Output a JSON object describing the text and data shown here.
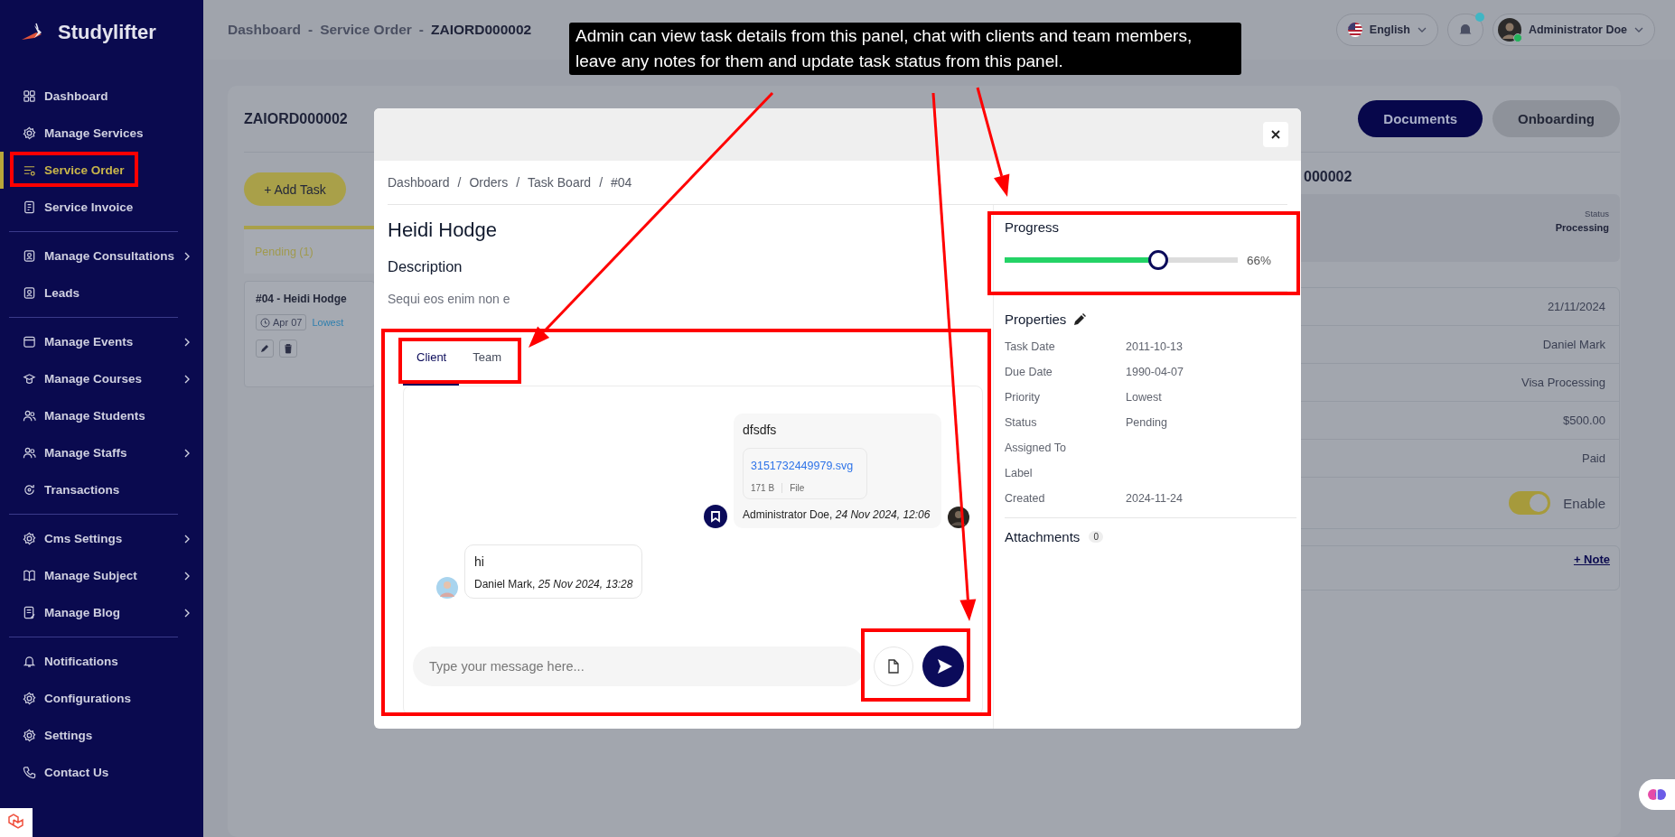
{
  "sidebar": {
    "brand": "Studylifter",
    "groups": [
      [
        {
          "label": "Dashboard",
          "selected": false,
          "has_submenu": false
        },
        {
          "label": "Manage Services",
          "selected": false,
          "has_submenu": false
        },
        {
          "label": "Service Order",
          "selected": true,
          "has_submenu": false
        },
        {
          "label": "Service Invoice",
          "selected": false,
          "has_submenu": false
        }
      ],
      [
        {
          "label": "Manage Consultations",
          "selected": false,
          "has_submenu": true
        },
        {
          "label": "Leads",
          "selected": false,
          "has_submenu": false
        }
      ],
      [
        {
          "label": "Manage Events",
          "selected": false,
          "has_submenu": true
        },
        {
          "label": "Manage Courses",
          "selected": false,
          "has_submenu": true
        },
        {
          "label": "Manage Students",
          "selected": false,
          "has_submenu": false
        },
        {
          "label": "Manage Staffs",
          "selected": false,
          "has_submenu": true
        },
        {
          "label": "Transactions",
          "selected": false,
          "has_submenu": false
        }
      ],
      [
        {
          "label": "Cms Settings",
          "selected": false,
          "has_submenu": true
        },
        {
          "label": "Manage Subject",
          "selected": false,
          "has_submenu": true
        },
        {
          "label": "Manage Blog",
          "selected": false,
          "has_submenu": true
        }
      ],
      [
        {
          "label": "Notifications",
          "selected": false,
          "has_submenu": false
        },
        {
          "label": "Configurations",
          "selected": false,
          "has_submenu": false
        },
        {
          "label": "Settings",
          "selected": false,
          "has_submenu": false
        },
        {
          "label": "Contact Us",
          "selected": false,
          "has_submenu": false
        }
      ]
    ]
  },
  "topbar": {
    "breadcrumb": [
      "Dashboard",
      "Service Order",
      "ZAIORD000002"
    ],
    "breadcrumb_separator": "-",
    "language": "English",
    "has_unread": true,
    "user": "Administrator Doe",
    "online": true
  },
  "page": {
    "order_id": "ZAIORD000002",
    "buttons": [
      {
        "label": "Documents",
        "selected": true
      },
      {
        "label": "Onboarding",
        "selected": false
      }
    ],
    "add_task": "+ Add Task",
    "column": {
      "title": "Pending (1)",
      "cards": [
        {
          "title": "#04 - Heidi Hodge",
          "date": "Apr 07",
          "priority": "Lowest"
        }
      ]
    },
    "heading_partial": "000002",
    "status_label": "Status",
    "status_value": "Processing",
    "details": [
      {
        "kind": "text",
        "value": "21/11/2024"
      },
      {
        "kind": "text",
        "value": "Daniel Mark"
      },
      {
        "kind": "text",
        "value": "Visa Processing"
      },
      {
        "kind": "text",
        "value": "$500.00"
      },
      {
        "kind": "text",
        "value": "Paid"
      },
      {
        "kind": "toggle",
        "on": true,
        "value": "Enable"
      }
    ],
    "note_link": "+ Note"
  },
  "modal": {
    "breadcrumb": [
      "Dashboard",
      "Orders",
      "Task Board",
      "#04"
    ],
    "breadcrumb_separator": "/",
    "title": "Heidi Hodge",
    "description_heading": "Description",
    "description": "Sequi eos enim non e",
    "chat": {
      "tabs": [
        {
          "label": "Client",
          "selected": true
        },
        {
          "label": "Team",
          "selected": false
        }
      ],
      "messages": [
        {
          "kind": "outgoing",
          "text": "dfsdfs",
          "file": {
            "name": "3151732449979.svg",
            "size": "171 B",
            "type": "File"
          },
          "meta": "Administrator Doe, *24 Nov 2024, 12:06*"
        },
        {
          "kind": "incoming",
          "text": "hi",
          "meta": "Daniel Mark, *25 Nov 2024, 13:28*"
        }
      ],
      "placeholder": "Type your message here..."
    },
    "progress": {
      "label": "Progress",
      "level": 0.66,
      "reading": "66%"
    },
    "properties": {
      "heading": "Properties",
      "rows": [
        {
          "label": "Task Date",
          "value": "2011-10-13"
        },
        {
          "label": "Due Date",
          "value": "1990-04-07"
        },
        {
          "label": "Priority",
          "value": "Lowest"
        },
        {
          "label": "Status",
          "value": "Pending"
        },
        {
          "label": "Assigned To"
        },
        {
          "label": "Label"
        },
        {
          "label": "Created",
          "value": "2024-11-24"
        }
      ]
    },
    "attachments": {
      "label": "Attachments",
      "count": "0"
    }
  },
  "annotation": {
    "text": "Admin can view task details from this panel, chat with clients and team members, leave any notes for them and update task status from this panel."
  }
}
